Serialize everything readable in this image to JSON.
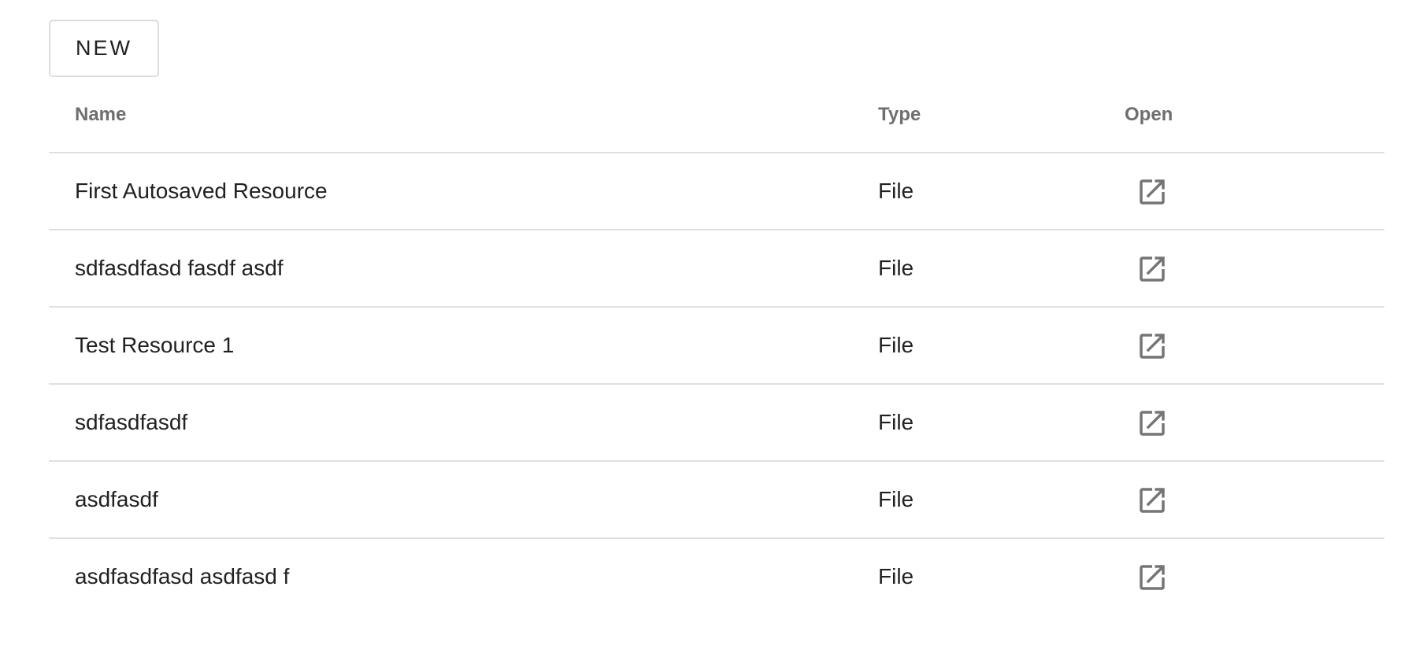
{
  "toolbar": {
    "new_label": "NEW"
  },
  "table": {
    "columns": {
      "name": "Name",
      "type": "Type",
      "open": "Open"
    },
    "rows": [
      {
        "name": "First Autosaved Resource",
        "type": "File",
        "open_icon": "open-in-new-icon"
      },
      {
        "name": "sdfasdfasd fasdf asdf",
        "type": "File",
        "open_icon": "open-in-new-icon"
      },
      {
        "name": "Test Resource 1",
        "type": "File",
        "open_icon": "open-in-new-icon"
      },
      {
        "name": "sdfasdfasdf",
        "type": "File",
        "open_icon": "open-in-new-icon"
      },
      {
        "name": "asdfasdf",
        "type": "File",
        "open_icon": "open-in-new-icon"
      },
      {
        "name": "asdfasdfasd asdfasd f",
        "type": "File",
        "open_icon": "open-in-new-icon"
      }
    ]
  },
  "colors": {
    "header_text": "#6e6e6e",
    "row_text": "#212121",
    "divider": "#e0e0e0",
    "icon": "#757575"
  }
}
